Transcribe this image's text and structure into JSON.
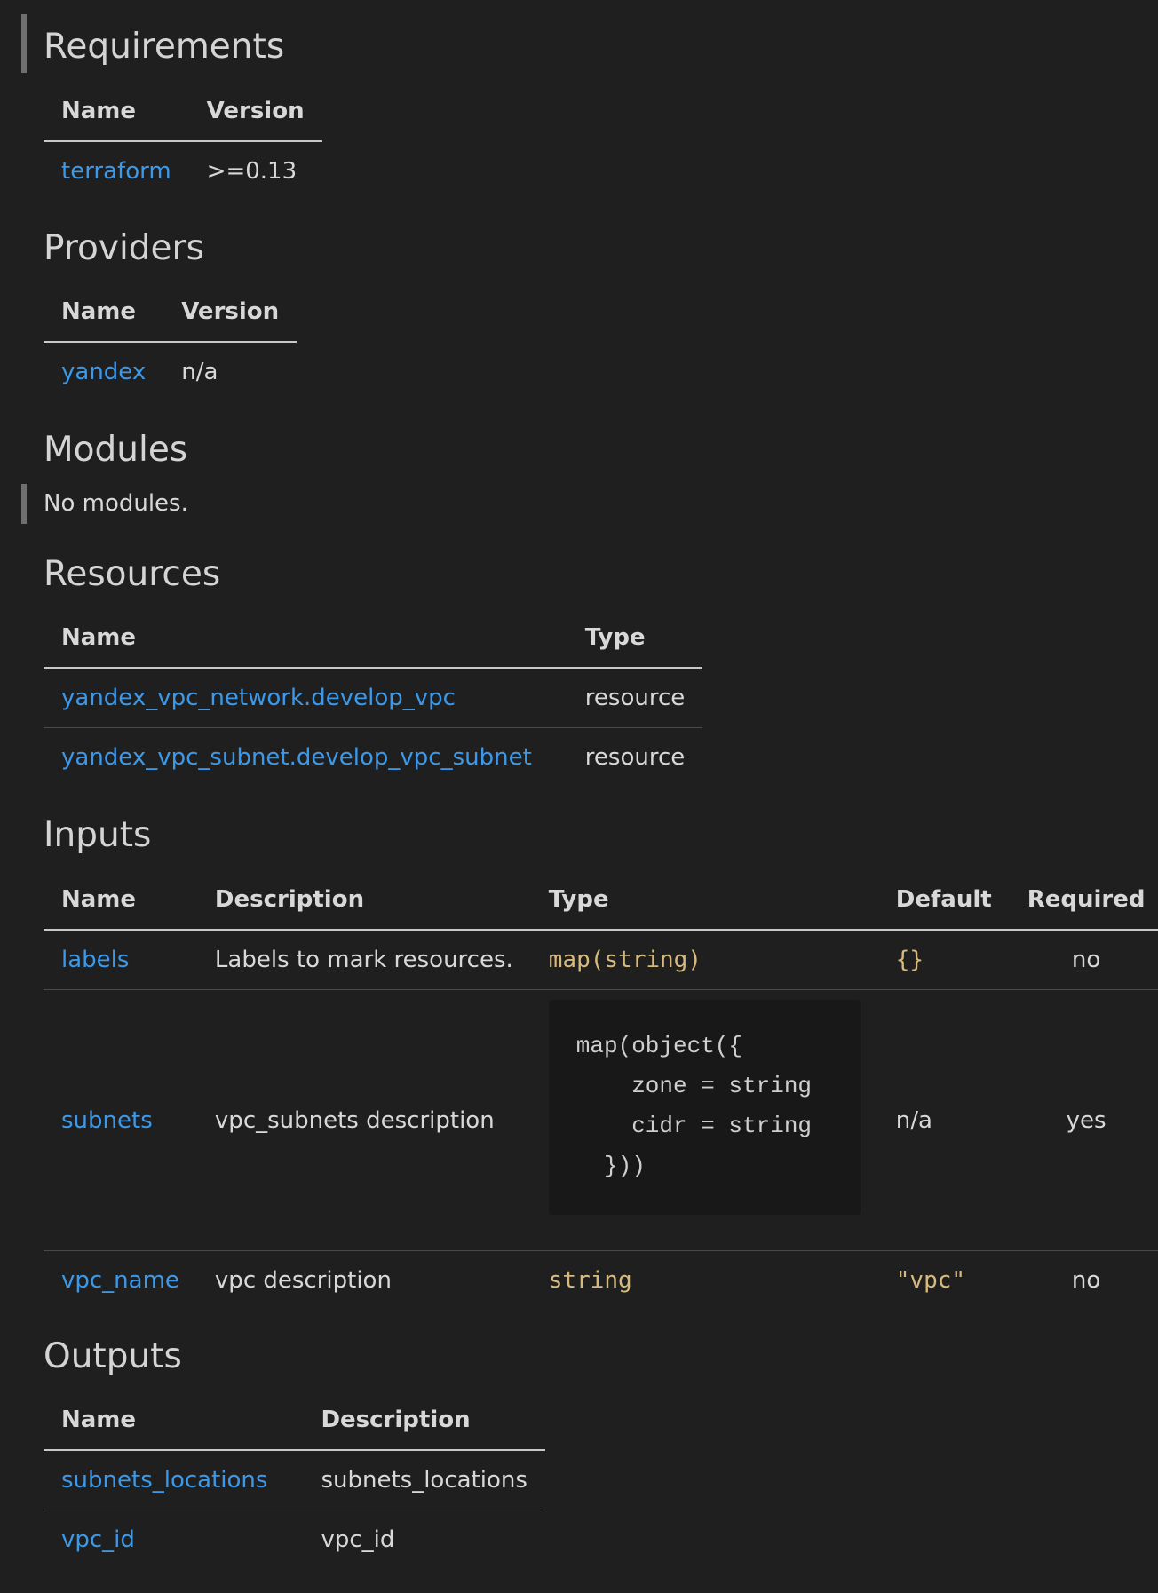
{
  "requirements": {
    "heading": "Requirements",
    "headers": [
      "Name",
      "Version"
    ],
    "rows": [
      {
        "name": "terraform",
        "version": ">=0.13"
      }
    ]
  },
  "providers": {
    "heading": "Providers",
    "headers": [
      "Name",
      "Version"
    ],
    "rows": [
      {
        "name": "yandex",
        "version": "n/a"
      }
    ]
  },
  "modules": {
    "heading": "Modules",
    "text": "No modules."
  },
  "resources": {
    "heading": "Resources",
    "headers": [
      "Name",
      "Type"
    ],
    "rows": [
      {
        "name": "yandex_vpc_network.develop_vpc",
        "type": "resource"
      },
      {
        "name": "yandex_vpc_subnet.develop_vpc_subnet",
        "type": "resource"
      }
    ]
  },
  "inputs": {
    "heading": "Inputs",
    "headers": [
      "Name",
      "Description",
      "Type",
      "Default",
      "Required"
    ],
    "rows": [
      {
        "name": "labels",
        "description": "Labels to mark resources.",
        "type": "map(string)",
        "default": "{}",
        "required": "no"
      },
      {
        "name": "subnets",
        "description": "vpc_subnets description",
        "type_block": "map(object({\n    zone = string\n    cidr = string\n  }))",
        "default": "n/a",
        "required": "yes"
      },
      {
        "name": "vpc_name",
        "description": "vpc description",
        "type": "string",
        "default": "\"vpc\"",
        "required": "no"
      }
    ]
  },
  "outputs": {
    "heading": "Outputs",
    "headers": [
      "Name",
      "Description"
    ],
    "rows": [
      {
        "name": "subnets_locations",
        "description": "subnets_locations"
      },
      {
        "name": "vpc_id",
        "description": "vpc_id"
      }
    ]
  }
}
